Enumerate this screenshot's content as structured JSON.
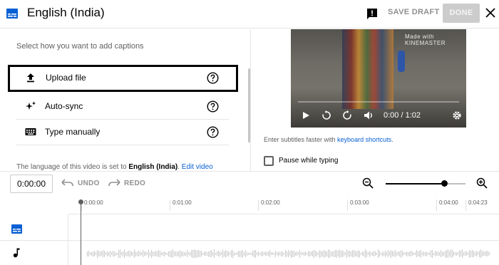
{
  "header": {
    "title": "English (India)",
    "save_draft_label": "SAVE DRAFT",
    "done_label": "DONE",
    "icons": [
      "subtitles-icon",
      "feedback-icon",
      "close-icon"
    ]
  },
  "left_panel": {
    "instruction": "Select how you want to add captions",
    "options": [
      {
        "label": "Upload file",
        "icon": "upload-icon",
        "highlighted": true
      },
      {
        "label": "Auto-sync",
        "icon": "sparkle-icon",
        "highlighted": false
      },
      {
        "label": "Type manually",
        "icon": "keyboard-icon",
        "highlighted": false
      }
    ],
    "language_note": {
      "prefix": "The language of this video is set to ",
      "language": "English (India)",
      "suffix": ". ",
      "link": "Edit video"
    }
  },
  "player": {
    "watermark": "Made with KINEMASTER",
    "current_time": "0:00 / 1:02",
    "progress_fraction": 0.0
  },
  "right_panel": {
    "shortcuts_prefix": "Enter subtitles faster with ",
    "shortcuts_link": "keyboard shortcuts",
    "shortcuts_suffix": ".",
    "pause_label": "Pause while typing",
    "pause_checked": false
  },
  "toolbar": {
    "time_value": "0:00:00",
    "undo_label": "UNDO",
    "redo_label": "REDO",
    "zoom_level_fraction": 0.73
  },
  "timeline": {
    "ticks": [
      "0:00:00",
      "0:01:00",
      "0:02:00",
      "0:03:00",
      "0:04:00",
      "0:04:23"
    ]
  },
  "colors": {
    "accent_blue": "#065fd4",
    "done_bg": "#cccccc",
    "text_secondary": "#606060"
  }
}
